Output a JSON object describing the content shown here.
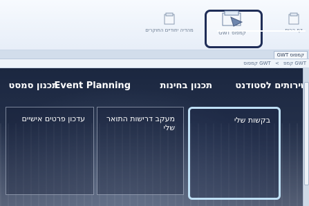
{
  "toolbar": {
    "home_label": "דף הבית",
    "campus_label": "קמפוס GWT",
    "research_label": "מהדיה יחודיים החוקרים",
    "home_icon": "folder-icon",
    "campus_icon": "campus-folder-icon",
    "research_icon": "folder-icon"
  },
  "tabstrip": {
    "active_tab": "GWT קמפוס"
  },
  "breadcrumb": {
    "items": [
      "GWT קמפ",
      ">",
      "GWT קמפוס"
    ]
  },
  "nav": {
    "students": "שירותים לסטודנט",
    "exams": "תכנון בחינות",
    "event": "Event Planning",
    "semester": "תכנון סמסט"
  },
  "tiles": {
    "requests": "בקשות שלי",
    "graduation": "מעקב דרישות התואר שלי",
    "personal": "עדכון פרטים אישיים"
  },
  "colors": {
    "highlight_dark": "#1f2d57",
    "highlight_light": "#bfe0f6",
    "portal_bg": "#1b2740"
  }
}
